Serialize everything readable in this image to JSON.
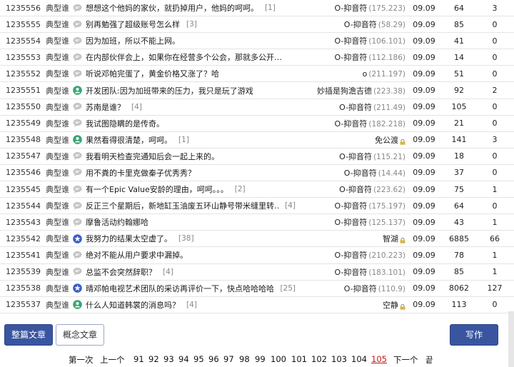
{
  "posts": [
    {
      "id": "1235556",
      "type": "典型谁",
      "icon": "speech-bubble-icon",
      "title": "想想这个他妈的家伙，就扔掉用户，他妈的呵呵。",
      "replies": "[1]",
      "author": "O-抑音符",
      "ip": "(175.223)",
      "locked": false,
      "date": "09.09",
      "views": "64",
      "count": "3"
    },
    {
      "id": "1235555",
      "type": "典型谁",
      "icon": "speech-bubble-icon",
      "title": "别再勉强了超级账号怎么样",
      "replies": "[3]",
      "author": "O-抑音符",
      "ip": "(58.29)",
      "locked": false,
      "date": "09.09",
      "views": "85",
      "count": "0"
    },
    {
      "id": "1235554",
      "type": "典型谁",
      "icon": "speech-bubble-icon",
      "title": "因为加班，所以不能上网。",
      "replies": "",
      "author": "O-抑音符",
      "ip": "(106.101)",
      "locked": false,
      "date": "09.09",
      "views": "41",
      "count": "0"
    },
    {
      "id": "1235553",
      "type": "典型谁",
      "icon": "speech-bubble-icon",
      "title": "在内部伙伴会上，如果你在经营多个公会，那就多公开…",
      "replies": "",
      "author": "O-抑音符",
      "ip": "(112.186)",
      "locked": false,
      "date": "09.09",
      "views": "14",
      "count": "0"
    },
    {
      "id": "1235552",
      "type": "典型谁",
      "icon": "speech-bubble-icon",
      "title": "听说邓帕完蛋了，黄金价格又涨了？哈",
      "replies": "",
      "author": "o",
      "ip": "(211.197)",
      "locked": false,
      "date": "09.09",
      "views": "51",
      "count": "0"
    },
    {
      "id": "1235551",
      "type": "典型谁",
      "icon": "person-badge-icon",
      "title": "开发团队:因为加班带来的压力，我只是玩了游戏",
      "replies": "",
      "author": "妙插是狗澹吉德",
      "ip": "(223.38)",
      "locked": false,
      "date": "09.09",
      "views": "92",
      "count": "2"
    },
    {
      "id": "1235550",
      "type": "典型谁",
      "icon": "speech-bubble-icon",
      "title": "苏南是谁？",
      "replies": "[4]",
      "author": "O-抑音符",
      "ip": "(211.49)",
      "locked": false,
      "date": "09.09",
      "views": "105",
      "count": "0"
    },
    {
      "id": "1235549",
      "type": "典型谁",
      "icon": "speech-bubble-icon",
      "title": "我试图隐瞒的是传奇。",
      "replies": "",
      "author": "O-抑音符",
      "ip": "(182.218)",
      "locked": false,
      "date": "09.09",
      "views": "21",
      "count": "0"
    },
    {
      "id": "1235548",
      "type": "典型谁",
      "icon": "person-badge-icon",
      "title": "果然看得很清楚，呵呵。",
      "replies": "[1]",
      "author": "免公渡",
      "ip": "",
      "locked": true,
      "date": "09.09",
      "views": "141",
      "count": "3"
    },
    {
      "id": "1235547",
      "type": "典型谁",
      "icon": "speech-bubble-icon",
      "title": "我看明天检查完通知后会一起上来的。",
      "replies": "",
      "author": "O-抑音符",
      "ip": "(115.21)",
      "locked": false,
      "date": "09.09",
      "views": "18",
      "count": "0"
    },
    {
      "id": "1235546",
      "type": "典型谁",
      "icon": "speech-bubble-icon",
      "title": "用不粪的卡里克做秦子优秀秀？",
      "replies": "",
      "author": "O-抑音符",
      "ip": "(14.44)",
      "locked": false,
      "date": "09.09",
      "views": "37",
      "count": "0"
    },
    {
      "id": "1235545",
      "type": "典型谁",
      "icon": "speech-bubble-icon",
      "title": "有一个Epic Value安龄的理由，呵呵。。。",
      "replies": "[2]",
      "author": "O-抑音符",
      "ip": "(223.62)",
      "locked": false,
      "date": "09.09",
      "views": "75",
      "count": "1"
    },
    {
      "id": "1235544",
      "type": "典型谁",
      "icon": "speech-bubble-icon",
      "title": "反正三个星期后，新地缸玉油废五环山静号带米缝里转…",
      "replies": "[4]",
      "author": "O-抑音符",
      "ip": "(175.197)",
      "locked": false,
      "date": "09.09",
      "views": "64",
      "count": "0"
    },
    {
      "id": "1235543",
      "type": "典型谁",
      "icon": "speech-bubble-icon",
      "title": "摩鲁活动约翰娜哈",
      "replies": "",
      "author": "O-抑音符",
      "ip": "(125.137)",
      "locked": false,
      "date": "09.09",
      "views": "43",
      "count": "1"
    },
    {
      "id": "1235542",
      "type": "典型谁",
      "icon": "star-badge-icon",
      "title": "我努力的结果太空虚了。",
      "replies": "[38]",
      "author": "智湖",
      "ip": "",
      "locked": true,
      "date": "09.09",
      "views": "6885",
      "count": "66"
    },
    {
      "id": "1235541",
      "type": "典型谁",
      "icon": "speech-bubble-icon",
      "title": "绝对不能从用户要求中漏掉。",
      "replies": "",
      "author": "O-抑音符",
      "ip": "(210.223)",
      "locked": false,
      "date": "09.09",
      "views": "78",
      "count": "1"
    },
    {
      "id": "1235539",
      "type": "典型谁",
      "icon": "speech-bubble-icon",
      "title": "总监不会突然辞职？",
      "replies": "[4]",
      "author": "O-抑音符",
      "ip": "(183.101)",
      "locked": false,
      "date": "09.09",
      "views": "85",
      "count": "1"
    },
    {
      "id": "1235538",
      "type": "典型谁",
      "icon": "star-badge-icon",
      "title": "晴邓帕电视艺术团队的采访再评价一下，快点哈哈哈哈",
      "replies": "[25]",
      "author": "O-抑音符",
      "ip": "(110.9)",
      "locked": false,
      "date": "09.09",
      "views": "8062",
      "count": "127"
    },
    {
      "id": "1235537",
      "type": "典型谁",
      "icon": "person-badge-icon",
      "title": "什么人知道韩裳的消息吗？",
      "replies": "[4]",
      "author": "空静",
      "ip": "",
      "locked": true,
      "date": "09.09",
      "views": "113",
      "count": "0"
    }
  ],
  "toolbar": {
    "all_posts_label": "整篇文章",
    "concept_posts_label": "概念文章",
    "write_label": "写作"
  },
  "pagination": {
    "first": "第一次",
    "prev": "上一个",
    "pages": [
      "91",
      "92",
      "93",
      "94",
      "95",
      "96",
      "97",
      "98",
      "99",
      "100",
      "101",
      "102",
      "103",
      "104",
      "105"
    ],
    "current": "105",
    "next": "下一个",
    "last": "끝"
  },
  "colors": {
    "accent": "#3a55a0",
    "current_page": "#c41212",
    "icon_gray": "#c4c4c4",
    "icon_green": "#3aa573",
    "icon_blue": "#3b5dc9"
  }
}
